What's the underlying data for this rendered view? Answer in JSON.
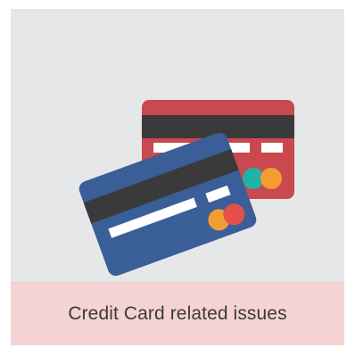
{
  "tile": {
    "caption": "Credit Card related issues",
    "illustration_icon": "credit-cards-icon"
  },
  "colors": {
    "tile_background": "#e6e7e9",
    "caption_background": "#f5d3d2",
    "back_card": "#c9494e",
    "front_card": "#3a5e98",
    "magnetic_stripe": "#3a3a3a",
    "orange_circle": "#f39c33",
    "red_circle": "#e5504c",
    "teal_circle": "#1fb4a6"
  }
}
